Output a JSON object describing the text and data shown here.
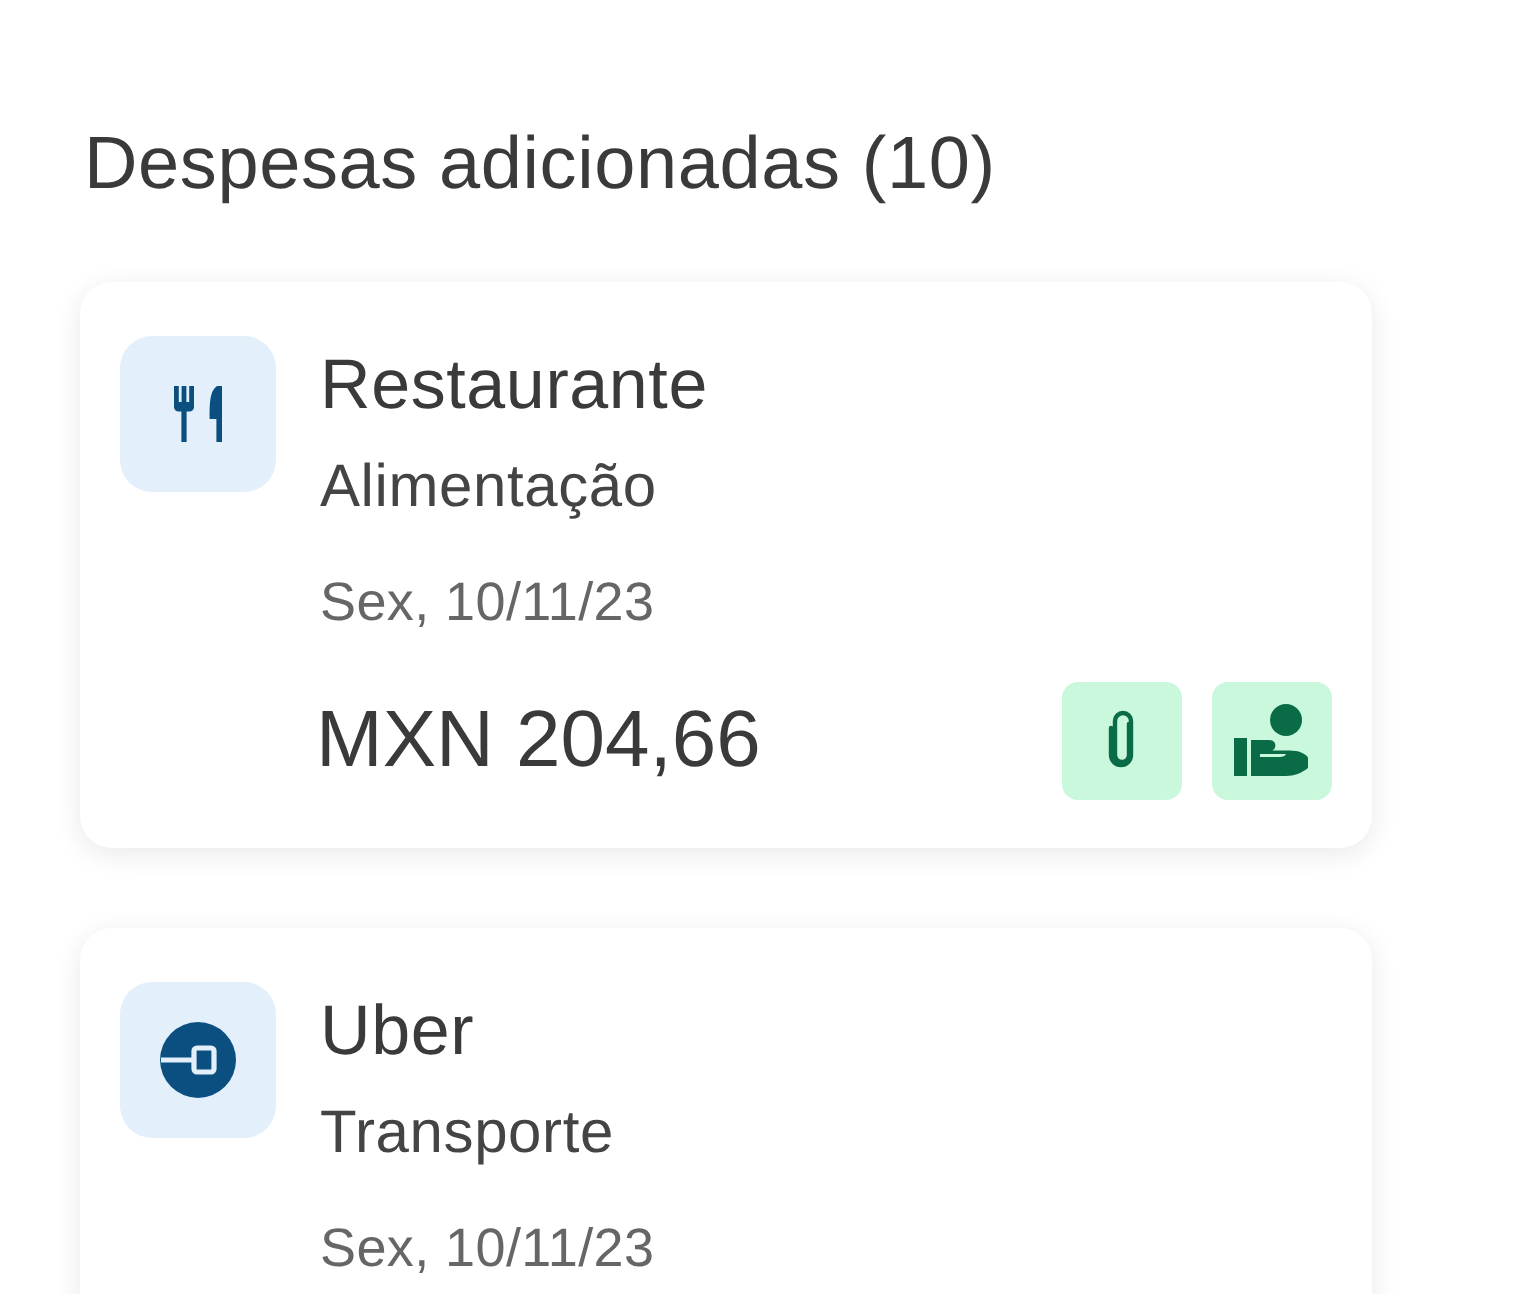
{
  "section": {
    "title": "Despesas adicionadas (10)"
  },
  "expenses": [
    {
      "kind": "food",
      "name": "Restaurante",
      "category": "Alimentação",
      "date": "Sex, 10/11/23",
      "amount": "MXN 204,66",
      "actions": [
        {
          "kind": "attachment"
        },
        {
          "kind": "reimbursement"
        }
      ]
    },
    {
      "kind": "transport",
      "name": "Uber",
      "category": "Transporte",
      "date": "Sex, 10/11/23"
    }
  ]
}
